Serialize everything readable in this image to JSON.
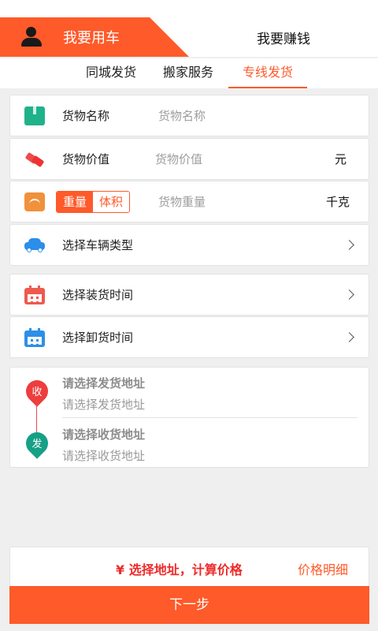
{
  "roles": {
    "active": "我要用车",
    "other": "我要赚钱"
  },
  "sub_tabs": [
    "同城发货",
    "搬家服务",
    "专线发货"
  ],
  "form": {
    "goods_name": {
      "label": "货物名称",
      "placeholder": "货物名称"
    },
    "goods_value": {
      "label": "货物价值",
      "placeholder": "货物价值",
      "unit": "元"
    },
    "goods_weight": {
      "toggle_on": "重量",
      "toggle_off": "体积",
      "placeholder": "货物重量",
      "unit": "千克"
    },
    "vehicle": {
      "label": "选择车辆类型"
    },
    "load_time": {
      "label": "选择装货时间"
    },
    "unload_time": {
      "label": "选择卸货时间"
    }
  },
  "address": {
    "from": {
      "badge": "收",
      "title": "请选择发货地址",
      "placeholder": "请选择发货地址"
    },
    "to": {
      "badge": "发",
      "title": "请选择收货地址",
      "placeholder": "请选择收货地址"
    }
  },
  "bottom": {
    "price_prompt": "¥ 选择地址，计算价格",
    "price_detail": "价格明细",
    "next": "下一步"
  },
  "colors": {
    "accent": "#fe5a2a",
    "price": "#ee2a2a"
  }
}
